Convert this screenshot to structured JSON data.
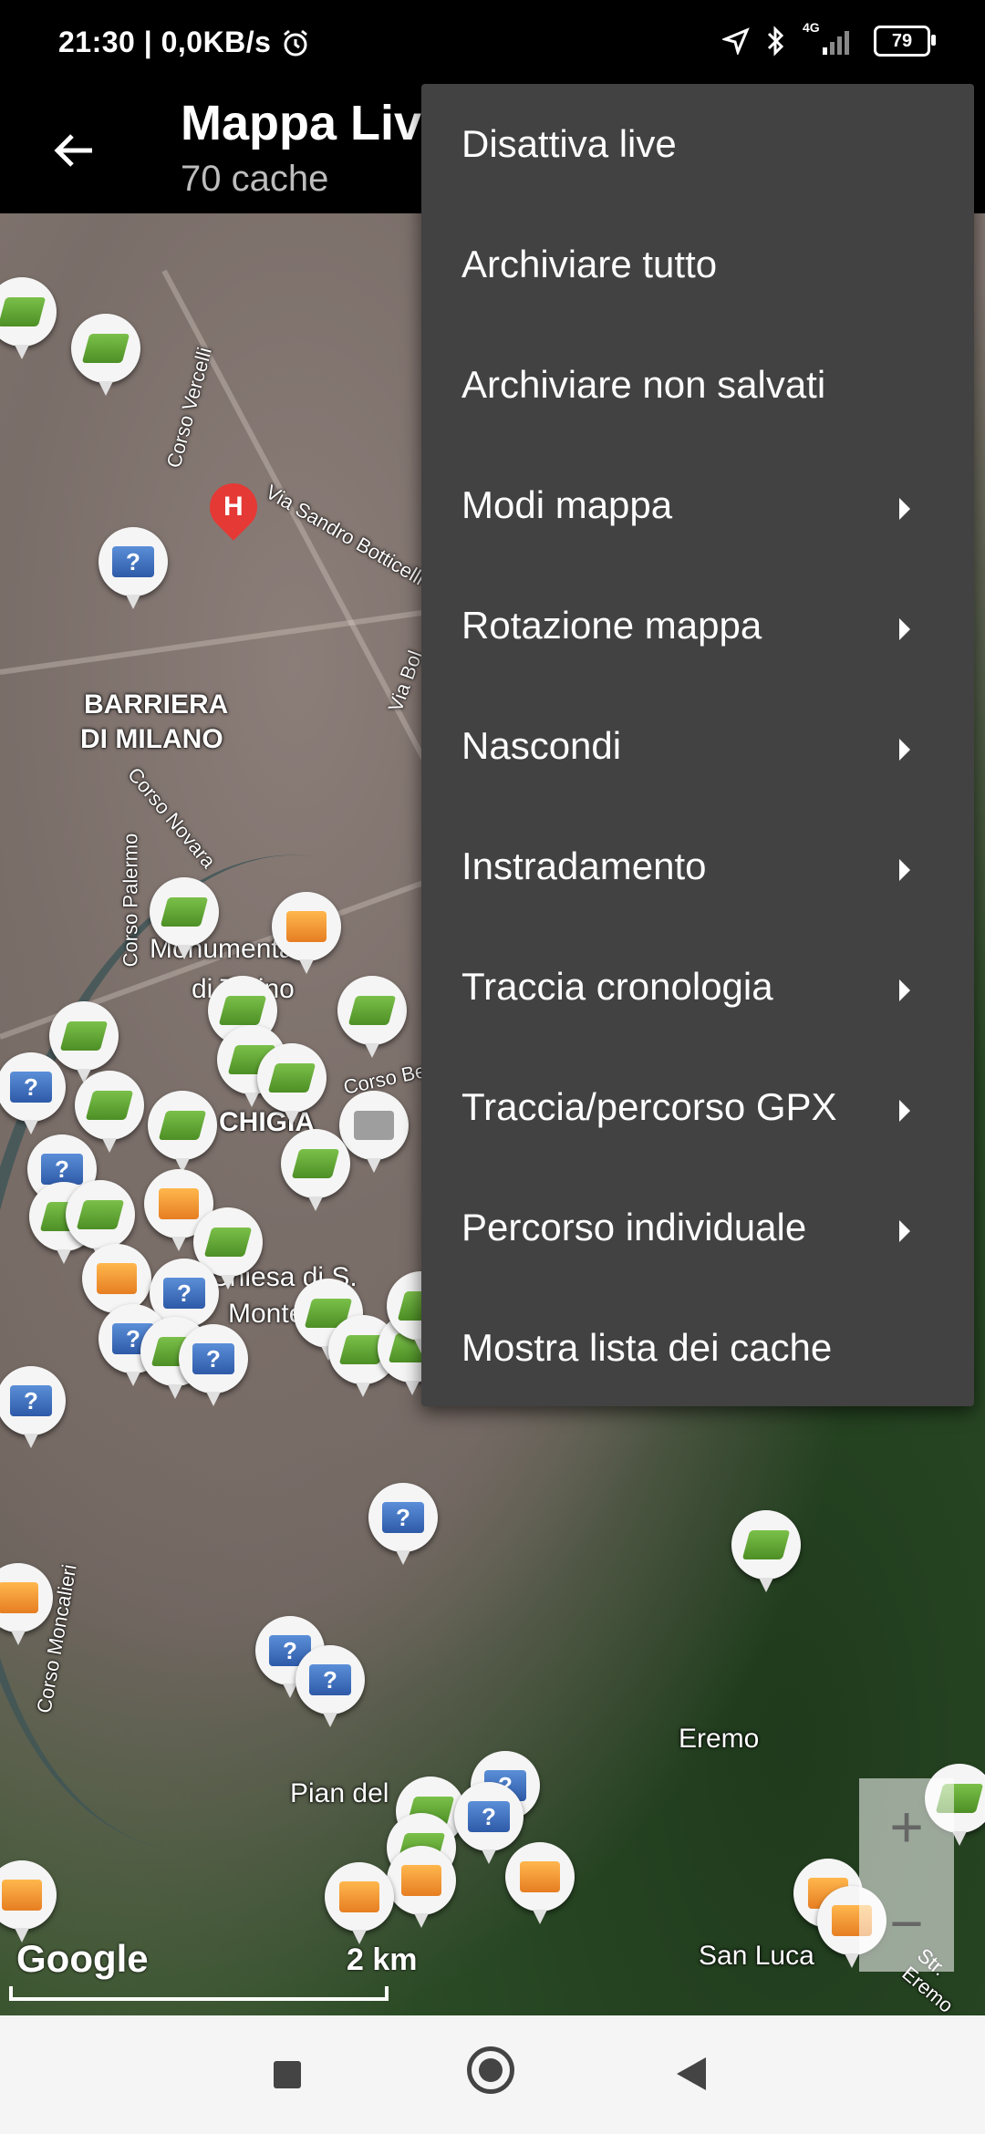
{
  "status_bar": {
    "time_and_speed": "21:30 | 0,0KB/s",
    "network": "4G",
    "battery": "79"
  },
  "appbar": {
    "title": "Mappa Live",
    "subtitle": "70 cache"
  },
  "map": {
    "labels": {
      "district1_line1": "BARRIERA",
      "district1_line2": "DI MILANO",
      "district2": "CHIGIA",
      "place1": "Eremo",
      "place2": "Pian del",
      "place3": "San Luca",
      "place4": "Monumentale",
      "place5": "di Torino",
      "place6": "Chiesa di S.",
      "place7": "Monte",
      "street1": "Corso Vercelli",
      "street2": "Via Sandro Botticelli",
      "street3": "Corso Novara",
      "street4": "Corso Palermo",
      "street5": "Corso Bel",
      "street6": "Via Bol",
      "street7": "Str. Eremo",
      "street8": "Corso Moncalieri"
    },
    "attribution": "Google",
    "scale": "2 km",
    "zoom_in": "+",
    "zoom_out": "−"
  },
  "menu": {
    "items": [
      {
        "label": "Disattiva live"
      },
      {
        "label": "Archiviare tutto"
      },
      {
        "label": "Archiviare non salvati"
      },
      {
        "label": "Modi mappa"
      },
      {
        "label": "Rotazione mappa"
      },
      {
        "label": "Nascondi"
      },
      {
        "label": "Instradamento"
      },
      {
        "label": "Traccia cronologia"
      },
      {
        "label": "Traccia/percorso GPX"
      },
      {
        "label": "Percorso individuale"
      },
      {
        "label": "Mostra lista dei cache"
      }
    ]
  }
}
